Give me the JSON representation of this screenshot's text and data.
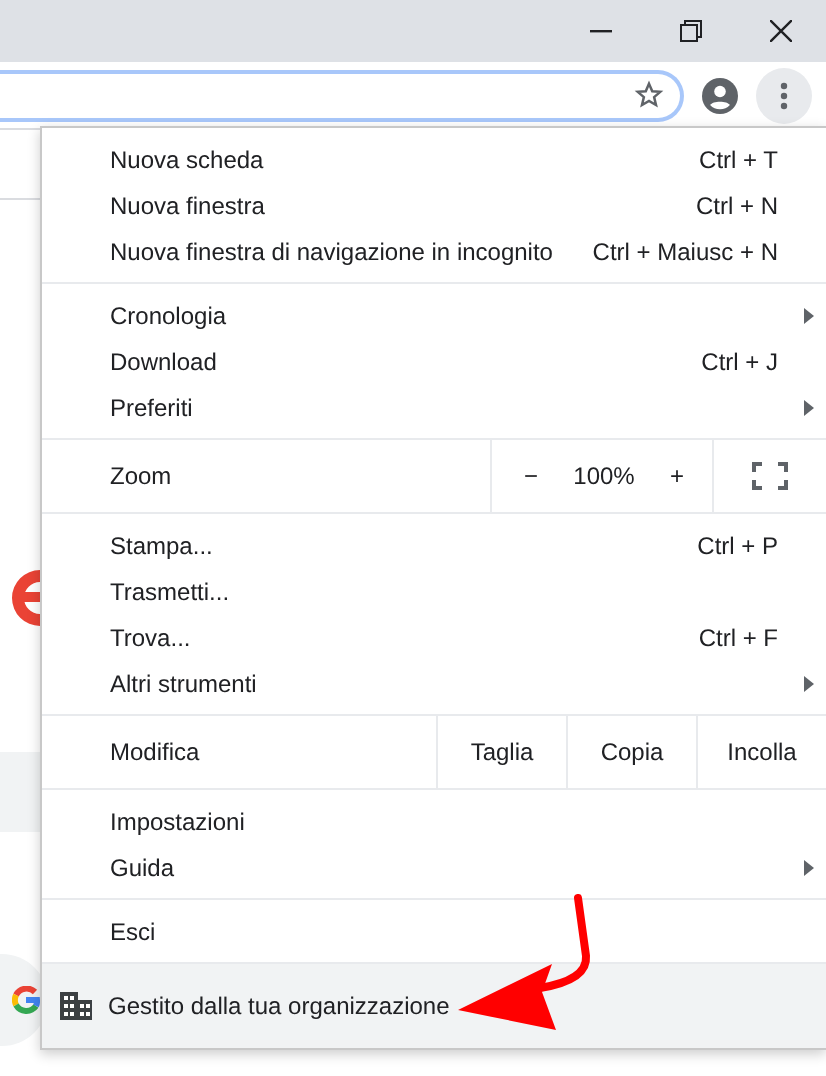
{
  "menu": {
    "sections": [
      {
        "rows": [
          {
            "kind": "item",
            "label": "Nuova scheda",
            "shortcut": "Ctrl + T",
            "submenu": false
          },
          {
            "kind": "item",
            "label": "Nuova finestra",
            "shortcut": "Ctrl + N",
            "submenu": false
          },
          {
            "kind": "item",
            "label": "Nuova finestra di navigazione in incognito",
            "shortcut": "Ctrl + Maiusc + N",
            "submenu": false
          }
        ]
      },
      {
        "rows": [
          {
            "kind": "item",
            "label": "Cronologia",
            "submenu": true
          },
          {
            "kind": "item",
            "label": "Download",
            "shortcut": "Ctrl + J",
            "submenu": false
          },
          {
            "kind": "item",
            "label": "Preferiti",
            "submenu": true
          }
        ]
      },
      {
        "rows": [
          {
            "kind": "zoom",
            "label": "Zoom",
            "minus": "−",
            "value": "100%",
            "plus": "+"
          }
        ]
      },
      {
        "rows": [
          {
            "kind": "item",
            "label": "Stampa...",
            "shortcut": "Ctrl + P",
            "submenu": false
          },
          {
            "kind": "item",
            "label": "Trasmetti...",
            "submenu": false
          },
          {
            "kind": "item",
            "label": "Trova...",
            "shortcut": "Ctrl + F",
            "submenu": false
          },
          {
            "kind": "item",
            "label": "Altri strumenti",
            "submenu": true
          }
        ]
      },
      {
        "rows": [
          {
            "kind": "edit",
            "label": "Modifica",
            "buttons": [
              "Taglia",
              "Copia",
              "Incolla"
            ]
          }
        ]
      },
      {
        "rows": [
          {
            "kind": "item",
            "label": "Impostazioni",
            "submenu": false
          },
          {
            "kind": "item",
            "label": "Guida",
            "submenu": true
          }
        ]
      },
      {
        "rows": [
          {
            "kind": "item",
            "label": "Esci",
            "submenu": false
          }
        ]
      }
    ],
    "managed": {
      "label": "Gestito dalla tua organizzazione"
    }
  }
}
